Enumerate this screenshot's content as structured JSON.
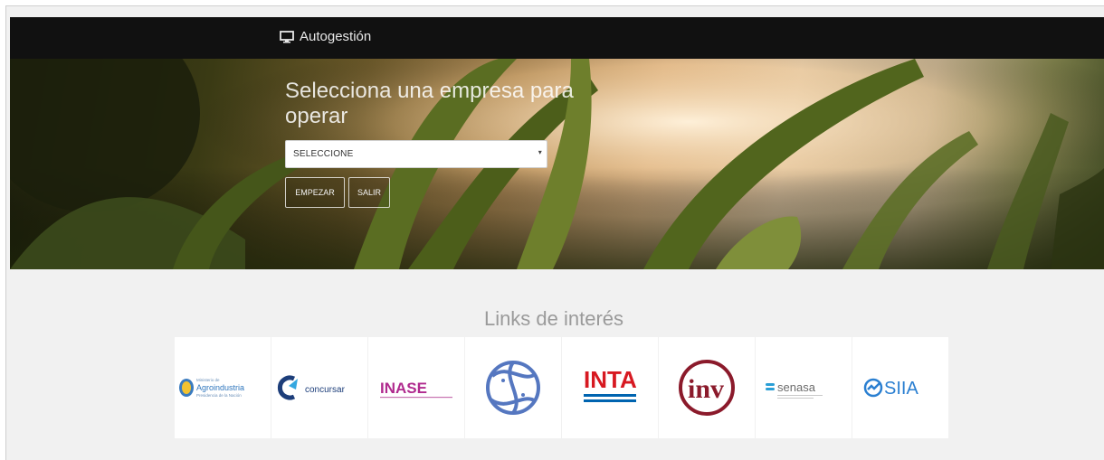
{
  "header": {
    "brand_label": "Autogestión",
    "icon": "monitor-icon"
  },
  "hero": {
    "title": "Selecciona una empresa para operar",
    "select_value": "SELECCIONE",
    "start_button": "EMPEZAR",
    "exit_button": "SALIR"
  },
  "links": {
    "title": "Links de interés",
    "items": [
      {
        "name": "Agroindustria",
        "sub1": "Ministerio de",
        "sub2": "Presidencia de la Nación"
      },
      {
        "name": "concursar"
      },
      {
        "name": "INASE"
      },
      {
        "name": "fish-emblem"
      },
      {
        "name": "INTA"
      },
      {
        "name": "inv"
      },
      {
        "name": "senasa"
      },
      {
        "name": "SIIA"
      }
    ]
  },
  "colors": {
    "topbar": "#111111",
    "inta_red": "#d71921",
    "inta_blue": "#0064b0",
    "inv_red": "#8b1a2b",
    "inase_purple": "#b02a8e",
    "siia_blue": "#2a7fd1",
    "fish_blue": "#5577c0"
  }
}
